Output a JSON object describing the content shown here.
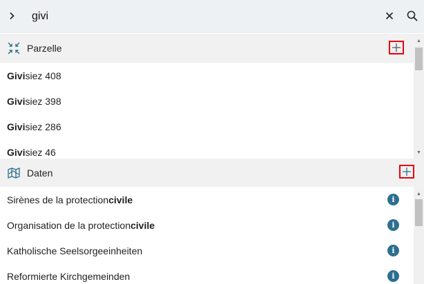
{
  "search": {
    "value": "givi",
    "placeholder": ""
  },
  "icons": {
    "expand": "chevron-right-icon",
    "clear": "close-icon",
    "search": "search-icon",
    "parzelle": "compress-arrows-icon",
    "daten": "map-layer-icon",
    "add": "plus-icon",
    "info": "info-icon"
  },
  "colors": {
    "highlight_border": "#e8000b",
    "accent": "#2c6f8f",
    "header_bg": "#eef1f3",
    "section_bg": "#f1f1f1"
  },
  "sections": [
    {
      "title": "Parzelle",
      "results": [
        {
          "match": "Givi",
          "rest": "siez 408"
        },
        {
          "match": "Givi",
          "rest": "siez 398"
        },
        {
          "match": "Givi",
          "rest": "siez 286"
        },
        {
          "match": "Givi",
          "rest": "siez 46"
        }
      ]
    },
    {
      "title": "Daten",
      "results": [
        {
          "pre": "Sirènes de la protection ",
          "match": "civile"
        },
        {
          "pre": "Organisation de la protection ",
          "match": "civile"
        },
        {
          "pre": "Katholische Seelsorgeeinheiten",
          "match": ""
        },
        {
          "pre": "Reformierte Kirchgemeinden",
          "match": ""
        }
      ]
    }
  ]
}
